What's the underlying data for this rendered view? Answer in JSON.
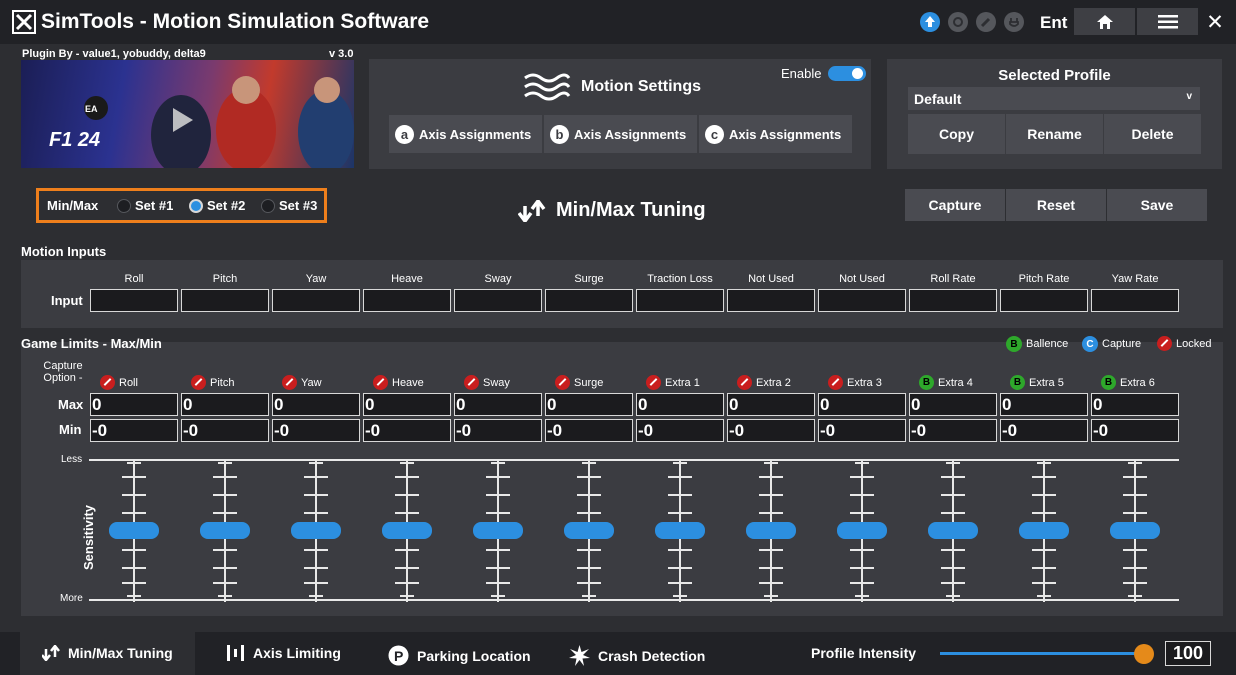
{
  "titlebar": {
    "title": "SimTools - Motion Simulation Software",
    "mode": "Ent",
    "icons": [
      "upload-icon",
      "gear-icon",
      "pencil-icon",
      "plug-icon",
      "home-icon",
      "menu-icon",
      "close-icon"
    ]
  },
  "plugin": {
    "credits": "Plugin By - value1, yobuddy, delta9",
    "version": "v 3.0",
    "image_title": "F1 24"
  },
  "motion_settings": {
    "title": "Motion Settings",
    "enable_label": "Enable",
    "enabled": true,
    "axis_buttons": [
      {
        "badge": "a",
        "label": "Axis Assignments"
      },
      {
        "badge": "b",
        "label": "Axis Assignments"
      },
      {
        "badge": "c",
        "label": "Axis Assignments"
      }
    ]
  },
  "profile": {
    "title": "Selected Profile",
    "selected": "Default",
    "buttons": [
      "Copy",
      "Rename",
      "Delete"
    ]
  },
  "minmax": {
    "label": "Min/Max",
    "sets": [
      "Set #1",
      "Set #2",
      "Set #3"
    ],
    "selected_index": 1,
    "title": "Min/Max Tuning",
    "actions": [
      "Capture",
      "Reset",
      "Save"
    ]
  },
  "motion_inputs": {
    "title": "Motion Inputs",
    "row_label": "Input",
    "columns": [
      "Roll",
      "Pitch",
      "Yaw",
      "Heave",
      "Sway",
      "Surge",
      "Traction Loss",
      "Not Used",
      "Not Used",
      "Roll Rate",
      "Pitch Rate",
      "Yaw Rate"
    ]
  },
  "game_limits": {
    "title": "Game Limits - Max/Min",
    "legend": [
      {
        "letter": "B",
        "label": "Ballence",
        "color": "#2ea82b"
      },
      {
        "letter": "C",
        "label": "Capture",
        "color": "#2c8fe0"
      },
      {
        "letter": "",
        "label": "Locked",
        "color": "#c91e1e"
      }
    ],
    "capture_option_label": "Capture Option -",
    "axes": [
      {
        "name": "Roll",
        "state": "locked"
      },
      {
        "name": "Pitch",
        "state": "locked"
      },
      {
        "name": "Yaw",
        "state": "locked"
      },
      {
        "name": "Heave",
        "state": "locked"
      },
      {
        "name": "Sway",
        "state": "locked"
      },
      {
        "name": "Surge",
        "state": "locked"
      },
      {
        "name": "Extra 1",
        "state": "locked"
      },
      {
        "name": "Extra 2",
        "state": "locked"
      },
      {
        "name": "Extra 3",
        "state": "locked"
      },
      {
        "name": "Extra 4",
        "state": "balance"
      },
      {
        "name": "Extra 5",
        "state": "balance"
      },
      {
        "name": "Extra 6",
        "state": "balance"
      }
    ],
    "max_label": "Max",
    "min_label": "Min",
    "max_values": [
      "0",
      "0",
      "0",
      "0",
      "0",
      "0",
      "0",
      "0",
      "0",
      "0",
      "0",
      "0"
    ],
    "min_values": [
      "-0",
      "-0",
      "-0",
      "-0",
      "-0",
      "-0",
      "-0",
      "-0",
      "-0",
      "-0",
      "-0",
      "-0"
    ],
    "sensitivity_label": "Sensitivity",
    "less_label": "Less",
    "more_label": "More",
    "sensitivity_level": 0.5
  },
  "bottom_tabs": [
    {
      "label": "Min/Max Tuning",
      "icon": "updown-arrows-icon",
      "active": true
    },
    {
      "label": "Axis Limiting",
      "icon": "bars-icon",
      "active": false
    },
    {
      "label": "Parking Location",
      "icon": "parking-icon",
      "active": false
    },
    {
      "label": "Crash Detection",
      "icon": "crash-icon",
      "active": false
    }
  ],
  "intensity": {
    "label": "Profile Intensity",
    "value": "100",
    "fraction": 1.0
  }
}
